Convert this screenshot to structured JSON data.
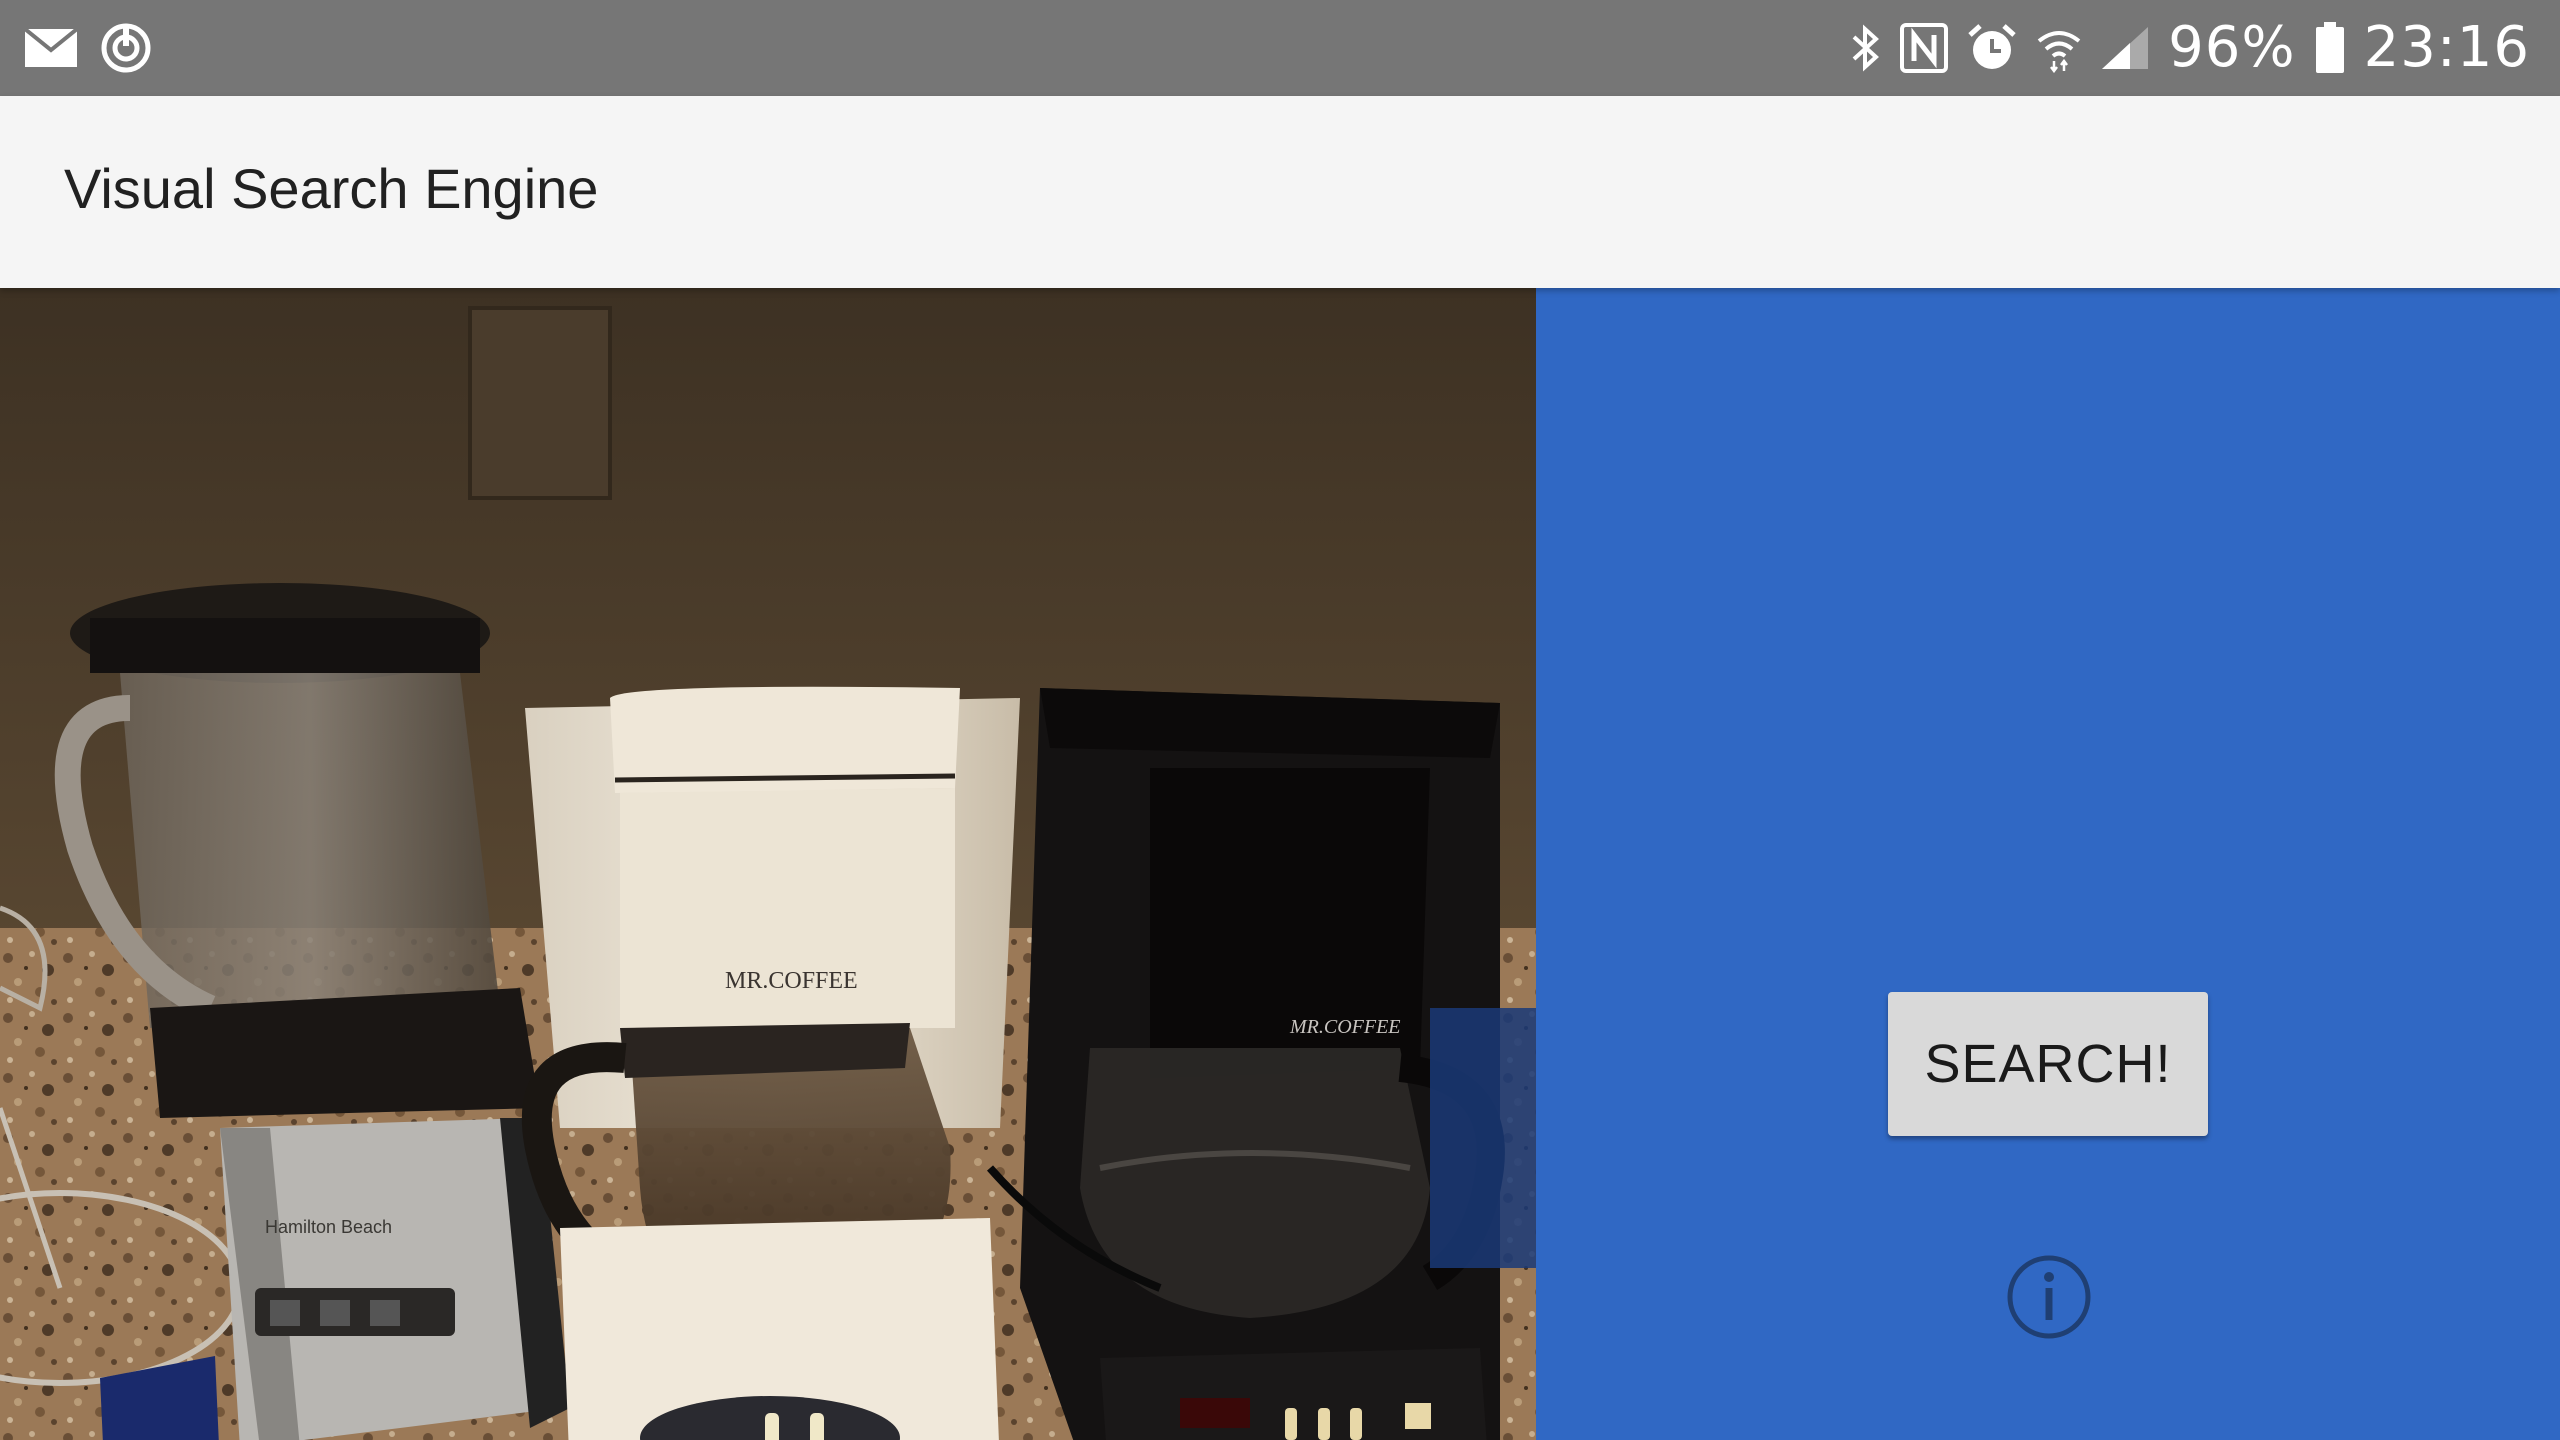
{
  "status_bar": {
    "battery": "96%",
    "time": "23:16",
    "left_icons": [
      "mail-icon",
      "sync-icon"
    ],
    "right_icons": [
      "bluetooth-icon",
      "nfc-icon",
      "alarm-icon",
      "wifi-icon",
      "signal-icon",
      "battery-icon"
    ]
  },
  "app_bar": {
    "title": "Visual Search Engine"
  },
  "preview": {
    "labels": {
      "coffee_maker_white": "MR.COFFEE",
      "coffee_maker_black": "MR.COFFEE",
      "blender": "Hamilton Beach"
    }
  },
  "panel": {
    "search_label": "SEARCH!",
    "info_icon": "info-icon"
  },
  "colors": {
    "status_bar": "#767676",
    "app_bar": "#f5f5f5",
    "panel": "#3068c4",
    "button": "#d9d9d9",
    "info_icon": "#1f3f73"
  }
}
